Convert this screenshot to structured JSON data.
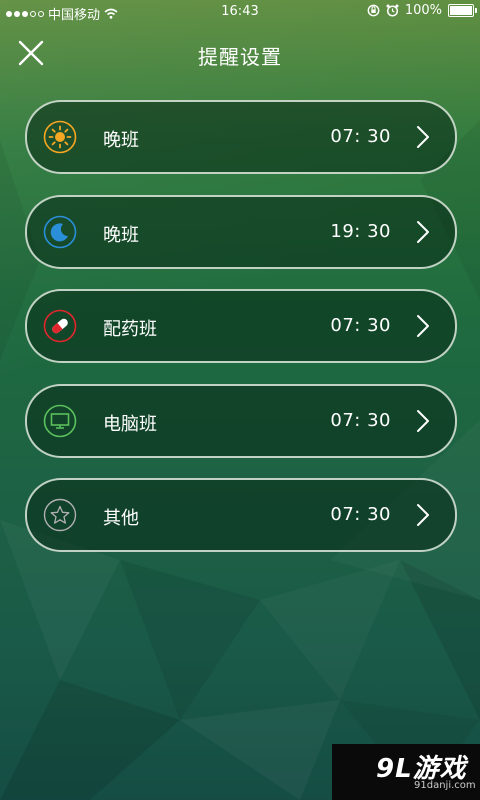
{
  "status_bar": {
    "carrier": "中国移动",
    "time": "16:43",
    "battery_text": "100%",
    "battery_level": 1.0
  },
  "header": {
    "title": "提醒设置",
    "close_icon": "close-icon"
  },
  "reminders": [
    {
      "label": "晚班",
      "time": "07:  30",
      "icon": "sun-icon",
      "color": "#f5a623"
    },
    {
      "label": "晚班",
      "time": "19:  30",
      "icon": "moon-icon",
      "color": "#2a8fd8"
    },
    {
      "label": "配药班",
      "time": "07:  30",
      "icon": "pill-icon",
      "color": "#e0262d"
    },
    {
      "label": "电脑班",
      "time": "07:  30",
      "icon": "monitor-icon",
      "color": "#5cc05c"
    },
    {
      "label": "其他",
      "time": "07:  30",
      "icon": "star-icon",
      "color": "#b0b0b0"
    }
  ],
  "watermark": {
    "logo": "9L游戏",
    "url": "91danji.com"
  }
}
